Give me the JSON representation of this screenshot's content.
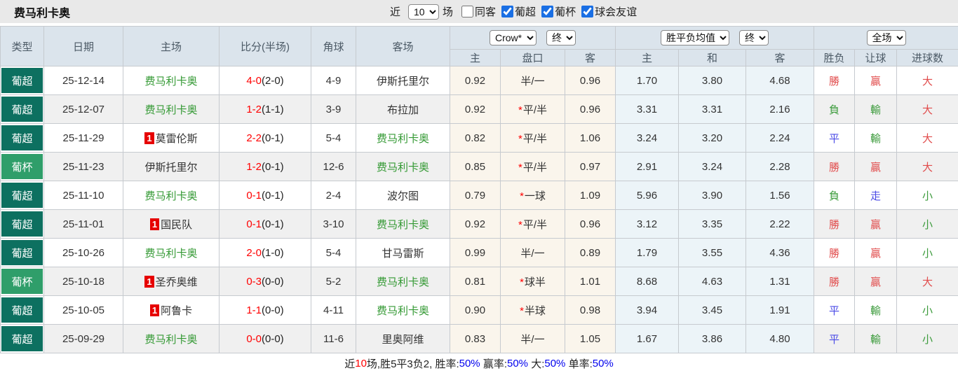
{
  "topbar": {
    "title": "费马利卡奥",
    "recent_label": "近",
    "recent_value": "10",
    "games_label": "场",
    "same_away": {
      "label": "同客",
      "checked": false
    },
    "league_filters": [
      {
        "label": "葡超",
        "checked": true
      },
      {
        "label": "葡杯",
        "checked": true
      },
      {
        "label": "球会友谊",
        "checked": true
      }
    ]
  },
  "table": {
    "main_headers": [
      "类型",
      "日期",
      "主场",
      "比分(半场)",
      "角球",
      "客场"
    ],
    "selects": {
      "company": "Crow*",
      "company_time": "终",
      "mean": "胜平负均值",
      "mean_time": "终",
      "scope": "全场"
    },
    "sub_headers": [
      "主",
      "盘口",
      "客",
      "主",
      "和",
      "客",
      "胜负",
      "让球",
      "进球数"
    ],
    "colors": {
      "league_badge": "#0d7060",
      "cup_badge": "#2f9e6a",
      "self_team_green": "#339933",
      "score_red": "#ff0000",
      "result_red": "#e14c4c",
      "result_green": "#3c9b3c",
      "result_blue": "#4a4ae6",
      "footer_blue": "#0000ee",
      "odds_bg": "#faf5ec",
      "mean_bg": "#ecf4f8"
    },
    "rows": [
      {
        "type": "葡超",
        "cup": false,
        "date": "25-12-14",
        "home": "费马利卡奥",
        "home_self": true,
        "home_badge": false,
        "score": "4-0",
        "half": "(2-0)",
        "corner": "4-9",
        "away": "伊斯托里尔",
        "away_self": false,
        "away_badge": false,
        "w_home": "0.92",
        "hcp": "半/一",
        "star": false,
        "w_away": "0.96",
        "m_home": "1.70",
        "m_draw": "3.80",
        "m_away": "4.68",
        "res": "勝",
        "res_c": "r",
        "let": "贏",
        "let_c": "r",
        "goal": "大",
        "goal_c": "r"
      },
      {
        "type": "葡超",
        "cup": false,
        "date": "25-12-07",
        "home": "费马利卡奥",
        "home_self": true,
        "home_badge": false,
        "score": "1-2",
        "half": "(1-1)",
        "corner": "3-9",
        "away": "布拉加",
        "away_self": false,
        "away_badge": false,
        "w_home": "0.92",
        "hcp": "平/半",
        "star": true,
        "w_away": "0.96",
        "m_home": "3.31",
        "m_draw": "3.31",
        "m_away": "2.16",
        "res": "負",
        "res_c": "g",
        "let": "輸",
        "let_c": "g",
        "goal": "大",
        "goal_c": "r"
      },
      {
        "type": "葡超",
        "cup": false,
        "date": "25-11-29",
        "home": "莫雷伦斯",
        "home_self": false,
        "home_badge": true,
        "score": "2-2",
        "half": "(0-1)",
        "corner": "5-4",
        "away": "费马利卡奥",
        "away_self": true,
        "away_badge": false,
        "w_home": "0.82",
        "hcp": "平/半",
        "star": true,
        "w_away": "1.06",
        "m_home": "3.24",
        "m_draw": "3.20",
        "m_away": "2.24",
        "res": "平",
        "res_c": "b",
        "let": "輸",
        "let_c": "g",
        "goal": "大",
        "goal_c": "r"
      },
      {
        "type": "葡杯",
        "cup": true,
        "date": "25-11-23",
        "home": "伊斯托里尔",
        "home_self": false,
        "home_badge": false,
        "score": "1-2",
        "half": "(0-1)",
        "corner": "12-6",
        "away": "费马利卡奥",
        "away_self": true,
        "away_badge": false,
        "w_home": "0.85",
        "hcp": "平/半",
        "star": true,
        "w_away": "0.97",
        "m_home": "2.91",
        "m_draw": "3.24",
        "m_away": "2.28",
        "res": "勝",
        "res_c": "r",
        "let": "贏",
        "let_c": "r",
        "goal": "大",
        "goal_c": "r"
      },
      {
        "type": "葡超",
        "cup": false,
        "date": "25-11-10",
        "home": "费马利卡奥",
        "home_self": true,
        "home_badge": false,
        "score": "0-1",
        "half": "(0-1)",
        "corner": "2-4",
        "away": "波尔图",
        "away_self": false,
        "away_badge": false,
        "w_home": "0.79",
        "hcp": "一球",
        "star": true,
        "w_away": "1.09",
        "m_home": "5.96",
        "m_draw": "3.90",
        "m_away": "1.56",
        "res": "負",
        "res_c": "g",
        "let": "走",
        "let_c": "b",
        "goal": "小",
        "goal_c": "g"
      },
      {
        "type": "葡超",
        "cup": false,
        "date": "25-11-01",
        "home": "国民队",
        "home_self": false,
        "home_badge": true,
        "score": "0-1",
        "half": "(0-1)",
        "corner": "3-10",
        "away": "费马利卡奥",
        "away_self": true,
        "away_badge": false,
        "w_home": "0.92",
        "hcp": "平/半",
        "star": true,
        "w_away": "0.96",
        "m_home": "3.12",
        "m_draw": "3.35",
        "m_away": "2.22",
        "res": "勝",
        "res_c": "r",
        "let": "贏",
        "let_c": "r",
        "goal": "小",
        "goal_c": "g"
      },
      {
        "type": "葡超",
        "cup": false,
        "date": "25-10-26",
        "home": "费马利卡奥",
        "home_self": true,
        "home_badge": false,
        "score": "2-0",
        "half": "(1-0)",
        "corner": "5-4",
        "away": "甘马雷斯",
        "away_self": false,
        "away_badge": false,
        "w_home": "0.99",
        "hcp": "半/一",
        "star": false,
        "w_away": "0.89",
        "m_home": "1.79",
        "m_draw": "3.55",
        "m_away": "4.36",
        "res": "勝",
        "res_c": "r",
        "let": "贏",
        "let_c": "r",
        "goal": "小",
        "goal_c": "g"
      },
      {
        "type": "葡杯",
        "cup": true,
        "date": "25-10-18",
        "home": "圣乔奥维",
        "home_self": false,
        "home_badge": true,
        "score": "0-3",
        "half": "(0-0)",
        "corner": "5-2",
        "away": "费马利卡奥",
        "away_self": true,
        "away_badge": false,
        "w_home": "0.81",
        "hcp": "球半",
        "star": true,
        "w_away": "1.01",
        "m_home": "8.68",
        "m_draw": "4.63",
        "m_away": "1.31",
        "res": "勝",
        "res_c": "r",
        "let": "贏",
        "let_c": "r",
        "goal": "大",
        "goal_c": "r"
      },
      {
        "type": "葡超",
        "cup": false,
        "date": "25-10-05",
        "home": "阿鲁卡",
        "home_self": false,
        "home_badge": true,
        "score": "1-1",
        "half": "(0-0)",
        "corner": "4-11",
        "away": "费马利卡奥",
        "away_self": true,
        "away_badge": false,
        "w_home": "0.90",
        "hcp": "半球",
        "star": true,
        "w_away": "0.98",
        "m_home": "3.94",
        "m_draw": "3.45",
        "m_away": "1.91",
        "res": "平",
        "res_c": "b",
        "let": "輸",
        "let_c": "g",
        "goal": "小",
        "goal_c": "g"
      },
      {
        "type": "葡超",
        "cup": false,
        "date": "25-09-29",
        "home": "费马利卡奥",
        "home_self": true,
        "home_badge": false,
        "score": "0-0",
        "half": "(0-0)",
        "corner": "11-6",
        "away": "里奥阿维",
        "away_self": false,
        "away_badge": false,
        "w_home": "0.83",
        "hcp": "半/一",
        "star": false,
        "w_away": "1.05",
        "m_home": "1.67",
        "m_draw": "3.86",
        "m_away": "4.80",
        "res": "平",
        "res_c": "b",
        "let": "輸",
        "let_c": "g",
        "goal": "小",
        "goal_c": "g"
      }
    ]
  },
  "footer": {
    "segments": [
      {
        "text": "近",
        "c": ""
      },
      {
        "text": "10",
        "c": "red"
      },
      {
        "text": "场,胜5平3负2, 胜率:",
        "c": ""
      },
      {
        "text": "50%",
        "c": "blue"
      },
      {
        "text": " 赢率:",
        "c": ""
      },
      {
        "text": "50%",
        "c": "blue"
      },
      {
        "text": " 大:",
        "c": ""
      },
      {
        "text": "50%",
        "c": "blue"
      },
      {
        "text": " 单率:",
        "c": ""
      },
      {
        "text": "50%",
        "c": "blue"
      }
    ]
  }
}
